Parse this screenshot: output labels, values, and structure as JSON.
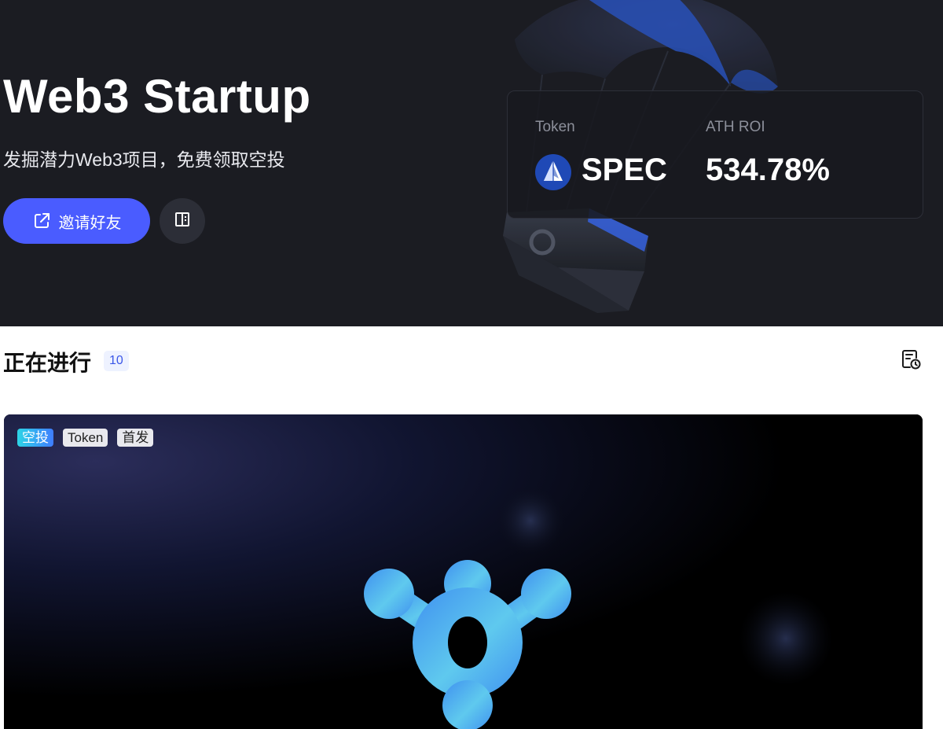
{
  "hero": {
    "title": "Web3 Startup",
    "subtitle": "发掘潜力Web3项目，免费领取空投",
    "invite_label": "邀请好友",
    "invite_icon": "external-link-icon",
    "doc_icon": "book-icon",
    "accent_color": "#4a5cff",
    "background_color": "#1b1c22"
  },
  "token_card": {
    "token_label": "Token",
    "roi_label": "ATH ROI",
    "token_name": "SPEC",
    "roi_value": "534.78%",
    "token_icon": "spec-token-logo"
  },
  "ongoing": {
    "title": "正在进行",
    "count": "10",
    "history_icon": "calendar-history-icon"
  },
  "project": {
    "tags": [
      "空投",
      "Token",
      "首发"
    ]
  }
}
